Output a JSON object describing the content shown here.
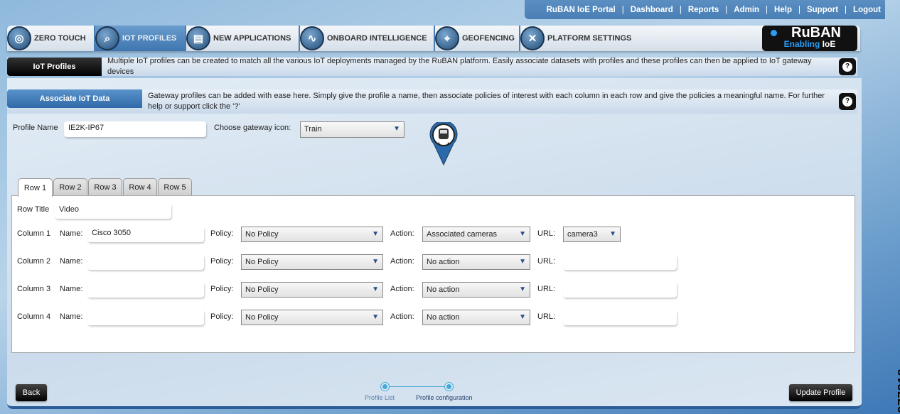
{
  "top_links": [
    "RuBAN IoE Portal",
    "Dashboard",
    "Reports",
    "Admin",
    "Help",
    "Support",
    "Logout"
  ],
  "nav_tabs": [
    {
      "label": "ZERO TOUCH",
      "icon": "disc-icon"
    },
    {
      "label": "IOT PROFILES",
      "icon": "document-search-icon",
      "active": true
    },
    {
      "label": "NEW APPLICATIONS",
      "icon": "app-gear-icon"
    },
    {
      "label": "ONBOARD INTELLIGENCE",
      "icon": "chart-gear-icon"
    },
    {
      "label": "GEOFENCING",
      "icon": "map-pin-icon"
    },
    {
      "label": "PLATFORM SETTINGS",
      "icon": "tools-icon"
    }
  ],
  "logo": {
    "line1": "RuBAN",
    "line2a": "Enabling",
    "line2b": "IoE"
  },
  "iot_bar": {
    "label": "IoT Profiles",
    "text": "Multiple IoT profiles can be created to match all the various IoT deployments managed by the RuBAN platform. Easily associate datasets with profiles and these profiles can then be applied to IoT gateway devices"
  },
  "assoc_bar": {
    "label": "Associate IoT Data",
    "text": "Gateway profiles can be added with ease here. Simply give the profile a name, then associate policies of interest with each column in each row and give the policies a meaningful name. For further help or support click the '?'"
  },
  "help_glyph": "?",
  "form": {
    "profile_name_label": "Profile Name",
    "profile_name_value": "IE2K-IP67",
    "gateway_icon_label": "Choose gateway icon:",
    "gateway_icon_value": "Train"
  },
  "row_tabs": [
    "Row 1",
    "Row 2",
    "Row 3",
    "Row 4",
    "Row 5"
  ],
  "row_title_label": "Row Title",
  "row_title_value": "Video",
  "labels": {
    "name": "Name:",
    "policy": "Policy:",
    "action": "Action:",
    "url": "URL:"
  },
  "columns": [
    {
      "label": "Column 1",
      "name": "Cisco 3050",
      "policy": "No Policy",
      "action": "Associated cameras",
      "url": "camera3"
    },
    {
      "label": "Column 2",
      "name": "",
      "policy": "No Policy",
      "action": "No action",
      "url": ""
    },
    {
      "label": "Column 3",
      "name": "",
      "policy": "No Policy",
      "action": "No action",
      "url": ""
    },
    {
      "label": "Column 4",
      "name": "",
      "policy": "No Policy",
      "action": "No action",
      "url": ""
    }
  ],
  "footer": {
    "back": "Back",
    "update": "Update Profile",
    "steps": [
      "Profile List",
      "Profile configuration"
    ]
  },
  "figure_id": "377218",
  "colors": {
    "accent": "#4a7fb5",
    "dark": "#111111",
    "step": "#4aa6d8"
  }
}
